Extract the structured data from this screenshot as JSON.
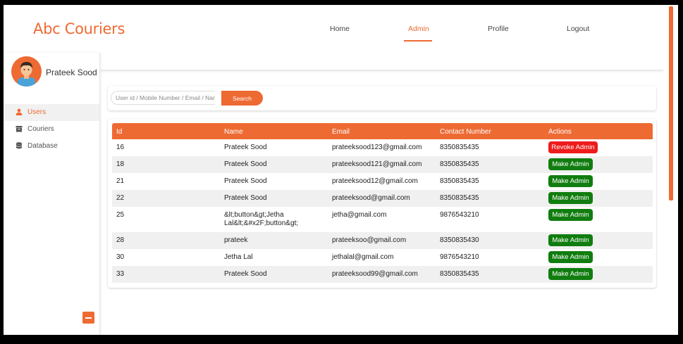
{
  "app": {
    "brand": "Abc Couriers"
  },
  "nav": [
    {
      "label": "Home",
      "active": false
    },
    {
      "label": "Admin",
      "active": true
    },
    {
      "label": "Profile",
      "active": false
    },
    {
      "label": "Logout",
      "active": false
    }
  ],
  "user": {
    "name": "Prateek Sood"
  },
  "sidebar": {
    "items": [
      {
        "label": "Users",
        "icon": "user-icon",
        "active": true
      },
      {
        "label": "Couriers",
        "icon": "archive-icon",
        "active": false
      },
      {
        "label": "Database",
        "icon": "database-icon",
        "active": false
      }
    ]
  },
  "search": {
    "placeholder": "User id / Mobile Number / Email / Name",
    "value": "",
    "button_label": "Search"
  },
  "table": {
    "headers": [
      "Id",
      "Name",
      "Email",
      "Contact Number",
      "Actions"
    ],
    "rows": [
      {
        "id": "16",
        "name": "Prateek Sood",
        "email": "prateeksood123@gmail.com",
        "contact": "8350835435",
        "action": "Revoke Admin",
        "action_type": "revoke"
      },
      {
        "id": "18",
        "name": "Prateek Sood",
        "email": "prateeksood121@gmail.com",
        "contact": "8350835435",
        "action": "Make Admin",
        "action_type": "make"
      },
      {
        "id": "21",
        "name": "Prateek Sood",
        "email": "prateeksood12@gmail.com",
        "contact": "8350835435",
        "action": "Make Admin",
        "action_type": "make"
      },
      {
        "id": "22",
        "name": "Prateek Sood",
        "email": "prateeksood@gmail.com",
        "contact": "8350835435",
        "action": "Make Admin",
        "action_type": "make"
      },
      {
        "id": "25",
        "name": "&lt;button&gt;Jetha Lal&lt;&#x2F;button&gt;",
        "email": "jetha@gmail.com",
        "contact": "9876543210",
        "action": "Make Admin",
        "action_type": "make"
      },
      {
        "id": "28",
        "name": "prateek",
        "email": "prateeksoo@gmail.com",
        "contact": "8350835430",
        "action": "Make Admin",
        "action_type": "make"
      },
      {
        "id": "30",
        "name": "Jetha Lal",
        "email": "jethalal@gmail.com",
        "contact": "9876543210",
        "action": "Make Admin",
        "action_type": "make"
      },
      {
        "id": "33",
        "name": "Prateek Sood",
        "email": "prateeksood99@gmail.com",
        "contact": "8350835435",
        "action": "Make Admin",
        "action_type": "make"
      }
    ]
  },
  "colors": {
    "accent": "#ee6a33",
    "make_admin": "#117d10",
    "revoke_admin": "#ee1c1c"
  }
}
